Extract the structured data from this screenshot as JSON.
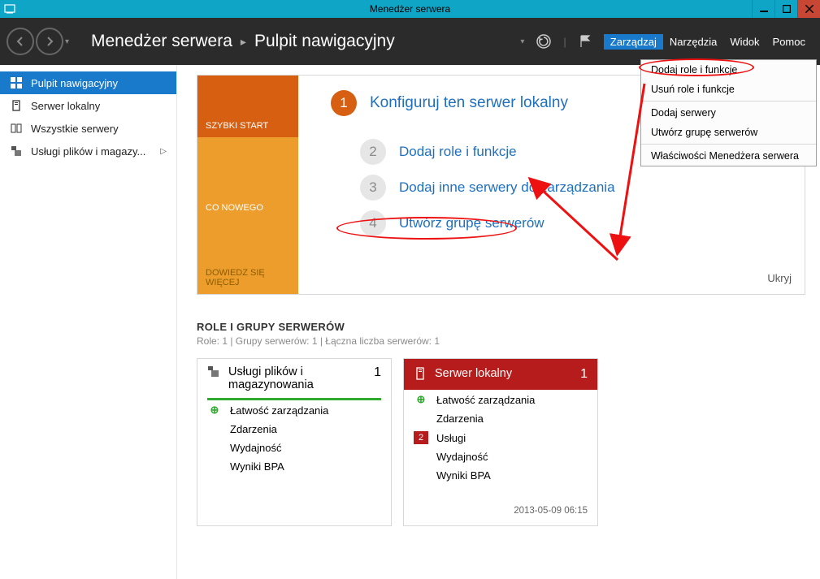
{
  "window": {
    "title": "Menedżer serwera"
  },
  "header": {
    "breadcrumb": [
      "Menedżer serwera",
      "Pulpit nawigacyjny"
    ],
    "menu": {
      "manage": "Zarządzaj",
      "tools": "Narzędzia",
      "view": "Widok",
      "help": "Pomoc"
    }
  },
  "dropdown": {
    "add_roles": "Dodaj role i funkcje",
    "remove_roles": "Usuń role i funkcje",
    "add_servers": "Dodaj serwery",
    "create_group": "Utwórz grupę serwerów",
    "properties": "Właściwości Menedżera serwera"
  },
  "sidebar": {
    "dashboard": "Pulpit nawigacyjny",
    "local_server": "Serwer lokalny",
    "all_servers": "Wszystkie serwery",
    "file_services": "Usługi plików i magazy..."
  },
  "welcome": {
    "tabs": {
      "quick": "SZYBKI START",
      "new": "CO NOWEGO",
      "learn": "DOWIEDZ SIĘ WIĘCEJ"
    },
    "step1": "Konfiguruj ten serwer lokalny",
    "step2": "Dodaj role i funkcje",
    "step3": "Dodaj inne serwery do zarządzania",
    "step4": "Utwórz grupę serwerów",
    "hide": "Ukryj"
  },
  "roles": {
    "heading": "ROLE I GRUPY SERWERÓW",
    "sub": "Role: 1 | Grupy serwerów: 1 | Łączna liczba serwerów: 1",
    "tile1": {
      "title": "Usługi plików i magazynowania",
      "count": "1",
      "rows": {
        "manage": "Łatwość zarządzania",
        "events": "Zdarzenia",
        "perf": "Wydajność",
        "bpa": "Wyniki BPA"
      }
    },
    "tile2": {
      "title": "Serwer lokalny",
      "count": "1",
      "rows": {
        "manage": "Łatwość zarządzania",
        "events": "Zdarzenia",
        "services": "Usługi",
        "services_badge": "2",
        "perf": "Wydajność",
        "bpa": "Wyniki BPA"
      },
      "timestamp": "2013-05-09 06:15"
    }
  }
}
